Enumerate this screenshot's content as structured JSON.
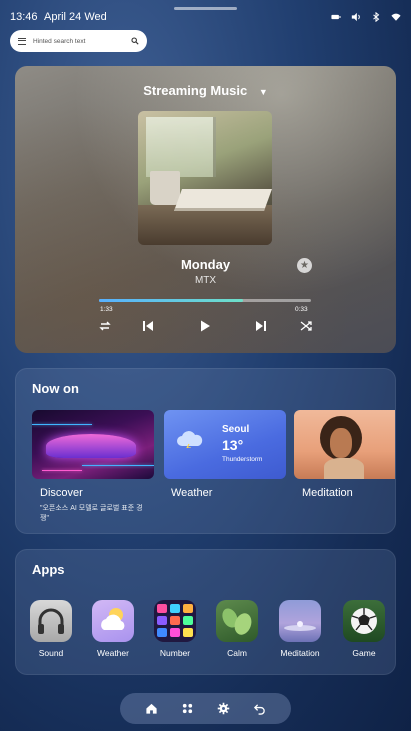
{
  "status_bar": {
    "time": "13:46",
    "date": "April 24 Wed",
    "icons": [
      "battery-icon",
      "volume-icon",
      "bluetooth-icon",
      "wifi-icon"
    ]
  },
  "search": {
    "placeholder": "Hinted search text",
    "icons": [
      "menu-icon",
      "search-icon"
    ]
  },
  "music_card": {
    "header": "Streaming Music",
    "song_title": "Monday",
    "artist": "MTX",
    "elapsed": "1:33",
    "remaining": "0:33",
    "progress_fraction": 0.68,
    "controls": [
      "repeat-icon",
      "previous-icon",
      "play-icon",
      "next-icon",
      "shuffle-icon"
    ]
  },
  "now_on": {
    "title": "Now on",
    "tiles": [
      {
        "label": "Discover",
        "subtitle": "\"오픈소스 AI 모델로 글로벌 표준 경쟁\""
      },
      {
        "label": "Weather",
        "city": "Seoul",
        "temp": "13°",
        "condition": "Thunderstorm"
      },
      {
        "label": "Meditation"
      }
    ]
  },
  "apps": {
    "title": "Apps",
    "items": [
      {
        "label": "Sound"
      },
      {
        "label": "Weather"
      },
      {
        "label": "Number"
      },
      {
        "label": "Calm"
      },
      {
        "label": "Meditation"
      },
      {
        "label": "Game"
      }
    ]
  },
  "dock": {
    "items": [
      "home-icon",
      "apps-grid-icon",
      "settings-icon",
      "back-icon"
    ]
  },
  "colors": {
    "accent_progress": "#57b0ff",
    "background": "#213f70",
    "weather_tile": "#4a6be0"
  }
}
